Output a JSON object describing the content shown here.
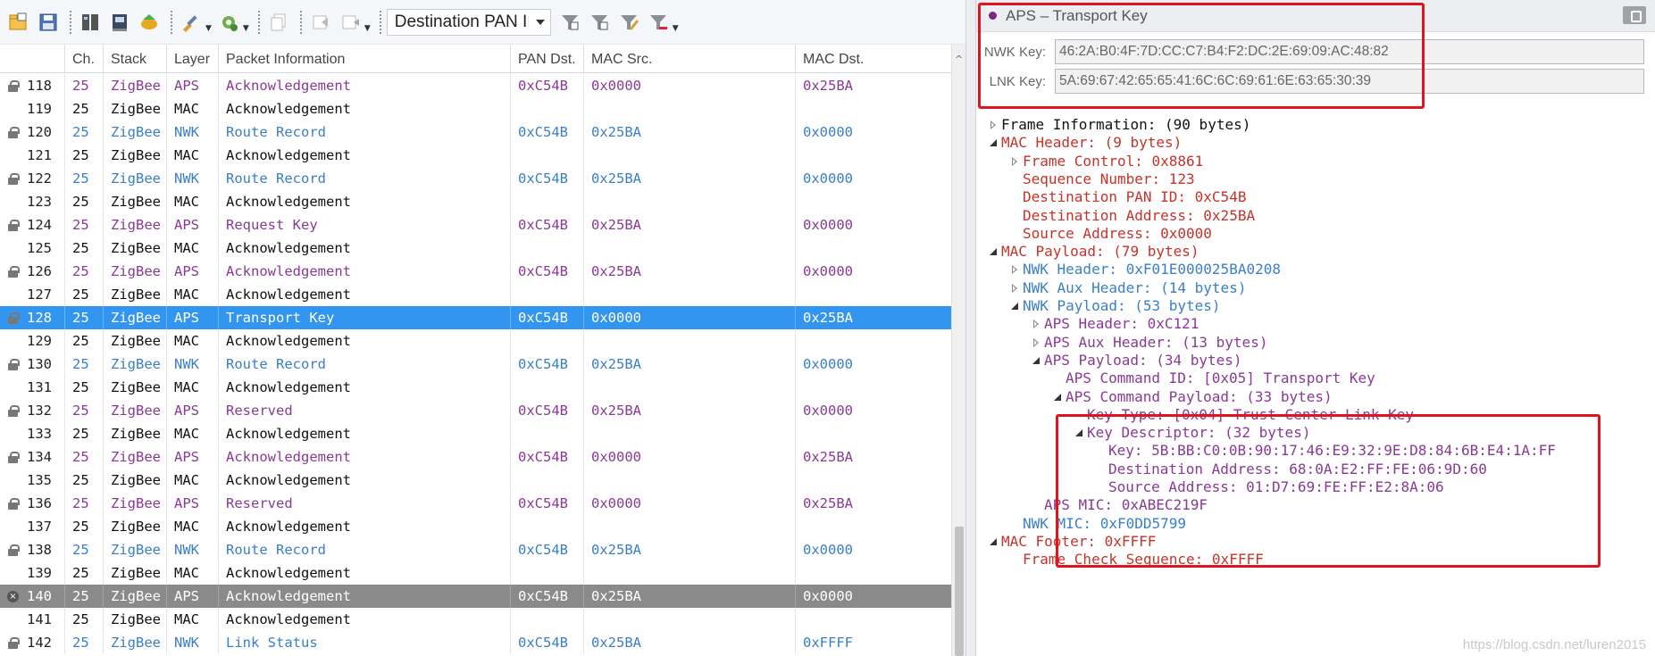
{
  "toolbar": {
    "pan_filter": "Destination PAN ID"
  },
  "columns": {
    "ch": "Ch.",
    "stack": "Stack",
    "layer": "Layer",
    "info": "Packet Information",
    "pan": "PAN Dst.",
    "src": "MAC Src.",
    "dst": "MAC Dst."
  },
  "packets": [
    {
      "num": "118",
      "ch": "25",
      "stack": "ZigBee",
      "layer": "APS",
      "info": "Acknowledgement",
      "pan": "0xC54B",
      "src": "0x0000",
      "dst": "0x25BA",
      "icon": "lock"
    },
    {
      "num": "119",
      "ch": "25",
      "stack": "ZigBee",
      "layer": "MAC",
      "info": "Acknowledgement",
      "pan": "",
      "src": "",
      "dst": "",
      "icon": ""
    },
    {
      "num": "120",
      "ch": "25",
      "stack": "ZigBee",
      "layer": "NWK",
      "info": "Route Record",
      "pan": "0xC54B",
      "src": "0x25BA",
      "dst": "0x0000",
      "icon": "lock"
    },
    {
      "num": "121",
      "ch": "25",
      "stack": "ZigBee",
      "layer": "MAC",
      "info": "Acknowledgement",
      "pan": "",
      "src": "",
      "dst": "",
      "icon": ""
    },
    {
      "num": "122",
      "ch": "25",
      "stack": "ZigBee",
      "layer": "NWK",
      "info": "Route Record",
      "pan": "0xC54B",
      "src": "0x25BA",
      "dst": "0x0000",
      "icon": "lock"
    },
    {
      "num": "123",
      "ch": "25",
      "stack": "ZigBee",
      "layer": "MAC",
      "info": "Acknowledgement",
      "pan": "",
      "src": "",
      "dst": "",
      "icon": ""
    },
    {
      "num": "124",
      "ch": "25",
      "stack": "ZigBee",
      "layer": "APS",
      "info": "Request Key",
      "pan": "0xC54B",
      "src": "0x25BA",
      "dst": "0x0000",
      "icon": "lock"
    },
    {
      "num": "125",
      "ch": "25",
      "stack": "ZigBee",
      "layer": "MAC",
      "info": "Acknowledgement",
      "pan": "",
      "src": "",
      "dst": "",
      "icon": ""
    },
    {
      "num": "126",
      "ch": "25",
      "stack": "ZigBee",
      "layer": "APS",
      "info": "Acknowledgement",
      "pan": "0xC54B",
      "src": "0x25BA",
      "dst": "0x0000",
      "icon": "lock"
    },
    {
      "num": "127",
      "ch": "25",
      "stack": "ZigBee",
      "layer": "MAC",
      "info": "Acknowledgement",
      "pan": "",
      "src": "",
      "dst": "",
      "icon": ""
    },
    {
      "num": "128",
      "ch": "25",
      "stack": "ZigBee",
      "layer": "APS",
      "info": "Transport Key",
      "pan": "0xC54B",
      "src": "0x0000",
      "dst": "0x25BA",
      "icon": "lock",
      "state": "selected"
    },
    {
      "num": "129",
      "ch": "25",
      "stack": "ZigBee",
      "layer": "MAC",
      "info": "Acknowledgement",
      "pan": "",
      "src": "",
      "dst": "",
      "icon": ""
    },
    {
      "num": "130",
      "ch": "25",
      "stack": "ZigBee",
      "layer": "NWK",
      "info": "Route Record",
      "pan": "0xC54B",
      "src": "0x25BA",
      "dst": "0x0000",
      "icon": "lock"
    },
    {
      "num": "131",
      "ch": "25",
      "stack": "ZigBee",
      "layer": "MAC",
      "info": "Acknowledgement",
      "pan": "",
      "src": "",
      "dst": "",
      "icon": ""
    },
    {
      "num": "132",
      "ch": "25",
      "stack": "ZigBee",
      "layer": "APS",
      "info": "Reserved",
      "pan": "0xC54B",
      "src": "0x25BA",
      "dst": "0x0000",
      "icon": "lock"
    },
    {
      "num": "133",
      "ch": "25",
      "stack": "ZigBee",
      "layer": "MAC",
      "info": "Acknowledgement",
      "pan": "",
      "src": "",
      "dst": "",
      "icon": ""
    },
    {
      "num": "134",
      "ch": "25",
      "stack": "ZigBee",
      "layer": "APS",
      "info": "Acknowledgement",
      "pan": "0xC54B",
      "src": "0x0000",
      "dst": "0x25BA",
      "icon": "lock"
    },
    {
      "num": "135",
      "ch": "25",
      "stack": "ZigBee",
      "layer": "MAC",
      "info": "Acknowledgement",
      "pan": "",
      "src": "",
      "dst": "",
      "icon": ""
    },
    {
      "num": "136",
      "ch": "25",
      "stack": "ZigBee",
      "layer": "APS",
      "info": "Reserved",
      "pan": "0xC54B",
      "src": "0x0000",
      "dst": "0x25BA",
      "icon": "lock"
    },
    {
      "num": "137",
      "ch": "25",
      "stack": "ZigBee",
      "layer": "MAC",
      "info": "Acknowledgement",
      "pan": "",
      "src": "",
      "dst": "",
      "icon": ""
    },
    {
      "num": "138",
      "ch": "25",
      "stack": "ZigBee",
      "layer": "NWK",
      "info": "Route Record",
      "pan": "0xC54B",
      "src": "0x25BA",
      "dst": "0x0000",
      "icon": "lock"
    },
    {
      "num": "139",
      "ch": "25",
      "stack": "ZigBee",
      "layer": "MAC",
      "info": "Acknowledgement",
      "pan": "",
      "src": "",
      "dst": "",
      "icon": ""
    },
    {
      "num": "140",
      "ch": "25",
      "stack": "ZigBee",
      "layer": "APS",
      "info": "Acknowledgement",
      "pan": "0xC54B",
      "src": "0x25BA",
      "dst": "0x0000",
      "icon": "error",
      "state": "error"
    },
    {
      "num": "141",
      "ch": "25",
      "stack": "ZigBee",
      "layer": "MAC",
      "info": "Acknowledgement",
      "pan": "",
      "src": "",
      "dst": "",
      "icon": ""
    },
    {
      "num": "142",
      "ch": "25",
      "stack": "ZigBee",
      "layer": "NWK",
      "info": "Link Status",
      "pan": "0xC54B",
      "src": "0x25BA",
      "dst": "0xFFFF",
      "icon": "lock"
    }
  ],
  "detail": {
    "title": "APS – Transport Key",
    "nwk_key_label": "NWK Key:",
    "nwk_key": "46:2A:B0:4F:7D:CC:C7:B4:F2:DC:2E:69:09:AC:48:82",
    "lnk_key_label": "LNK Key:",
    "lnk_key": "5A:69:67:42:65:65:41:6C:6C:69:61:6E:63:65:30:39",
    "tree": [
      {
        "text": "Frame Information: (90 bytes)",
        "level": 0,
        "toggle": "closed",
        "color": "black"
      },
      {
        "text": "MAC Header: (9 bytes)",
        "level": 0,
        "toggle": "open",
        "color": "red"
      },
      {
        "text": "Frame Control: 0x8861",
        "level": 1,
        "toggle": "closed",
        "color": "red"
      },
      {
        "text": "Sequence Number: 123",
        "level": 1,
        "toggle": "",
        "color": "red"
      },
      {
        "text": "Destination PAN ID: 0xC54B",
        "level": 1,
        "toggle": "",
        "color": "red"
      },
      {
        "text": "Destination Address: 0x25BA",
        "level": 1,
        "toggle": "",
        "color": "red"
      },
      {
        "text": "Source Address: 0x0000",
        "level": 1,
        "toggle": "",
        "color": "red"
      },
      {
        "text": "MAC Payload: (79 bytes)",
        "level": 0,
        "toggle": "open",
        "color": "red"
      },
      {
        "text": "NWK Header: 0xF01E000025BA0208",
        "level": 1,
        "toggle": "closed",
        "color": "blue"
      },
      {
        "text": "NWK Aux Header: (14 bytes)",
        "level": 1,
        "toggle": "closed",
        "color": "blue"
      },
      {
        "text": "NWK Payload: (53 bytes)",
        "level": 1,
        "toggle": "open",
        "color": "blue"
      },
      {
        "text": "APS Header: 0xC121",
        "level": 2,
        "toggle": "closed",
        "color": "purple"
      },
      {
        "text": "APS Aux Header: (13 bytes)",
        "level": 2,
        "toggle": "closed",
        "color": "purple"
      },
      {
        "text": "APS Payload: (34 bytes)",
        "level": 2,
        "toggle": "open",
        "color": "purple"
      },
      {
        "text": "APS Command ID: [0x05] Transport Key",
        "level": 3,
        "toggle": "",
        "color": "purple"
      },
      {
        "text": "APS Command Payload: (33 bytes)",
        "level": 3,
        "toggle": "open",
        "color": "purple"
      },
      {
        "text": "Key Type: [0x04] Trust Center Link Key",
        "level": 4,
        "toggle": "",
        "color": "purple"
      },
      {
        "text": "Key Descriptor: (32 bytes)",
        "level": 4,
        "toggle": "open",
        "color": "purple"
      },
      {
        "text": "Key: 5B:BB:C0:0B:90:17:46:E9:32:9E:D8:84:6B:E4:1A:FF",
        "level": 5,
        "toggle": "",
        "color": "purple"
      },
      {
        "text": "Destination Address: 68:0A:E2:FF:FE:06:9D:60",
        "level": 5,
        "toggle": "",
        "color": "purple"
      },
      {
        "text": "Source Address: 01:D7:69:FE:FF:E2:8A:06",
        "level": 5,
        "toggle": "",
        "color": "purple"
      },
      {
        "text": "APS MIC: 0xABEC219F",
        "level": 2,
        "toggle": "",
        "color": "purple"
      },
      {
        "text": "NWK MIC: 0xF0DD5799",
        "level": 1,
        "toggle": "",
        "color": "blue"
      },
      {
        "text": "MAC Footer: 0xFFFF",
        "level": 0,
        "toggle": "open",
        "color": "red"
      },
      {
        "text": "Frame Check Sequence: 0xFFFF",
        "level": 1,
        "toggle": "",
        "color": "red"
      }
    ]
  },
  "watermark": "https://blog.csdn.net/luren2015",
  "colors": {
    "aps": "#8a3a96",
    "nwk": "#3a7fc8",
    "mac": "#111111",
    "selected_row": "#3296f0",
    "error_row": "#8a8a8a",
    "highlight_box": "#e0141e"
  }
}
